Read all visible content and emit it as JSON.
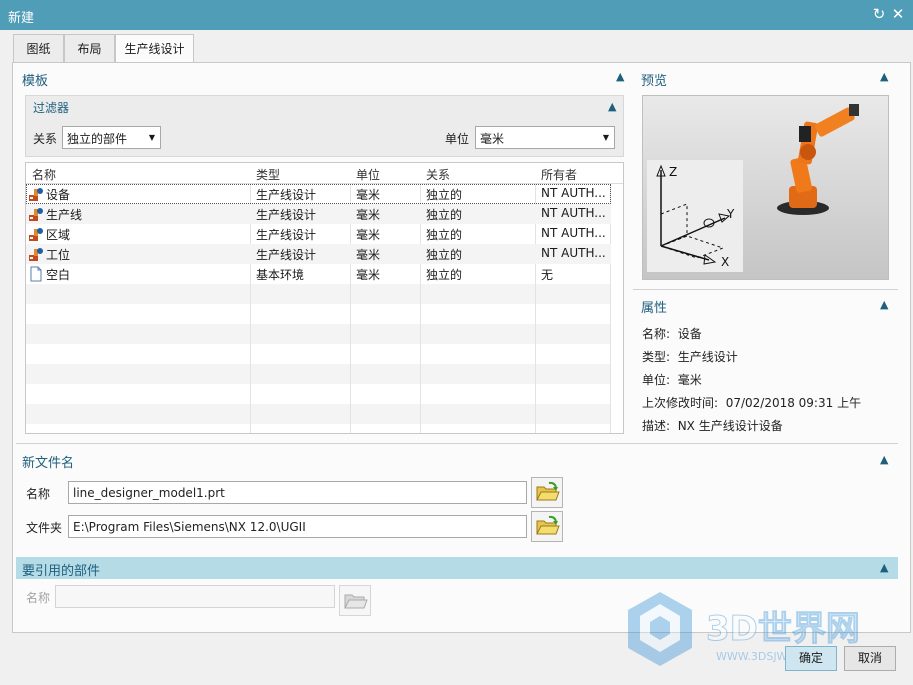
{
  "window": {
    "title": "新建",
    "reset_icon": "refresh-icon",
    "close_icon": "close-icon"
  },
  "tabs": [
    {
      "label": "图纸"
    },
    {
      "label": "布局"
    },
    {
      "label": "生产线设计"
    }
  ],
  "template": {
    "title": "模板",
    "filter": {
      "title": "过滤器",
      "relation_label": "关系",
      "relation_value": "独立的部件",
      "unit_label": "单位",
      "unit_value": "毫米"
    },
    "columns": [
      "名称",
      "类型",
      "单位",
      "关系",
      "所有者"
    ],
    "rows": [
      {
        "name": "设备",
        "type": "生产线设计",
        "unit": "毫米",
        "relation": "独立的",
        "owner": "NT AUTH...",
        "icon": "assembly-robot-icon"
      },
      {
        "name": "生产线",
        "type": "生产线设计",
        "unit": "毫米",
        "relation": "独立的",
        "owner": "NT AUTH...",
        "icon": "assembly-robot-icon"
      },
      {
        "name": "区域",
        "type": "生产线设计",
        "unit": "毫米",
        "relation": "独立的",
        "owner": "NT AUTH...",
        "icon": "assembly-robot-icon"
      },
      {
        "name": "工位",
        "type": "生产线设计",
        "unit": "毫米",
        "relation": "独立的",
        "owner": "NT AUTH...",
        "icon": "assembly-robot-icon"
      },
      {
        "name": "空白",
        "type": "基本环境",
        "unit": "毫米",
        "relation": "独立的",
        "owner": "无",
        "icon": "blank-file-icon"
      }
    ]
  },
  "preview": {
    "title": "预览",
    "axes": {
      "z": "Z",
      "y": "Y",
      "x": "X"
    }
  },
  "properties": {
    "title": "属性",
    "items": [
      {
        "label": "名称:",
        "value": "设备"
      },
      {
        "label": "类型:",
        "value": "生产线设计"
      },
      {
        "label": "单位:",
        "value": "毫米"
      },
      {
        "label": "上次修改时间:",
        "value": "07/02/2018 09:31 上午"
      },
      {
        "label": "描述:",
        "value": "NX 生产线设计设备"
      }
    ]
  },
  "new_filename": {
    "title": "新文件名",
    "name_label": "名称",
    "name_value": "line_designer_model1.prt",
    "folder_label": "文件夹",
    "folder_value": "E:\\Program Files\\Siemens\\NX 12.0\\UGII"
  },
  "referenced_parts": {
    "title": "要引用的部件",
    "name_label": "名称",
    "name_value": ""
  },
  "buttons": {
    "ok": "确定",
    "cancel": "取消"
  },
  "watermark": {
    "brand": "3D世界网",
    "url": "WWW.3DSJW.COM"
  },
  "colors": {
    "titlebar": "#4f9db7",
    "section_title": "#1e5f7e",
    "section_highlight": "#b4dbe6"
  }
}
